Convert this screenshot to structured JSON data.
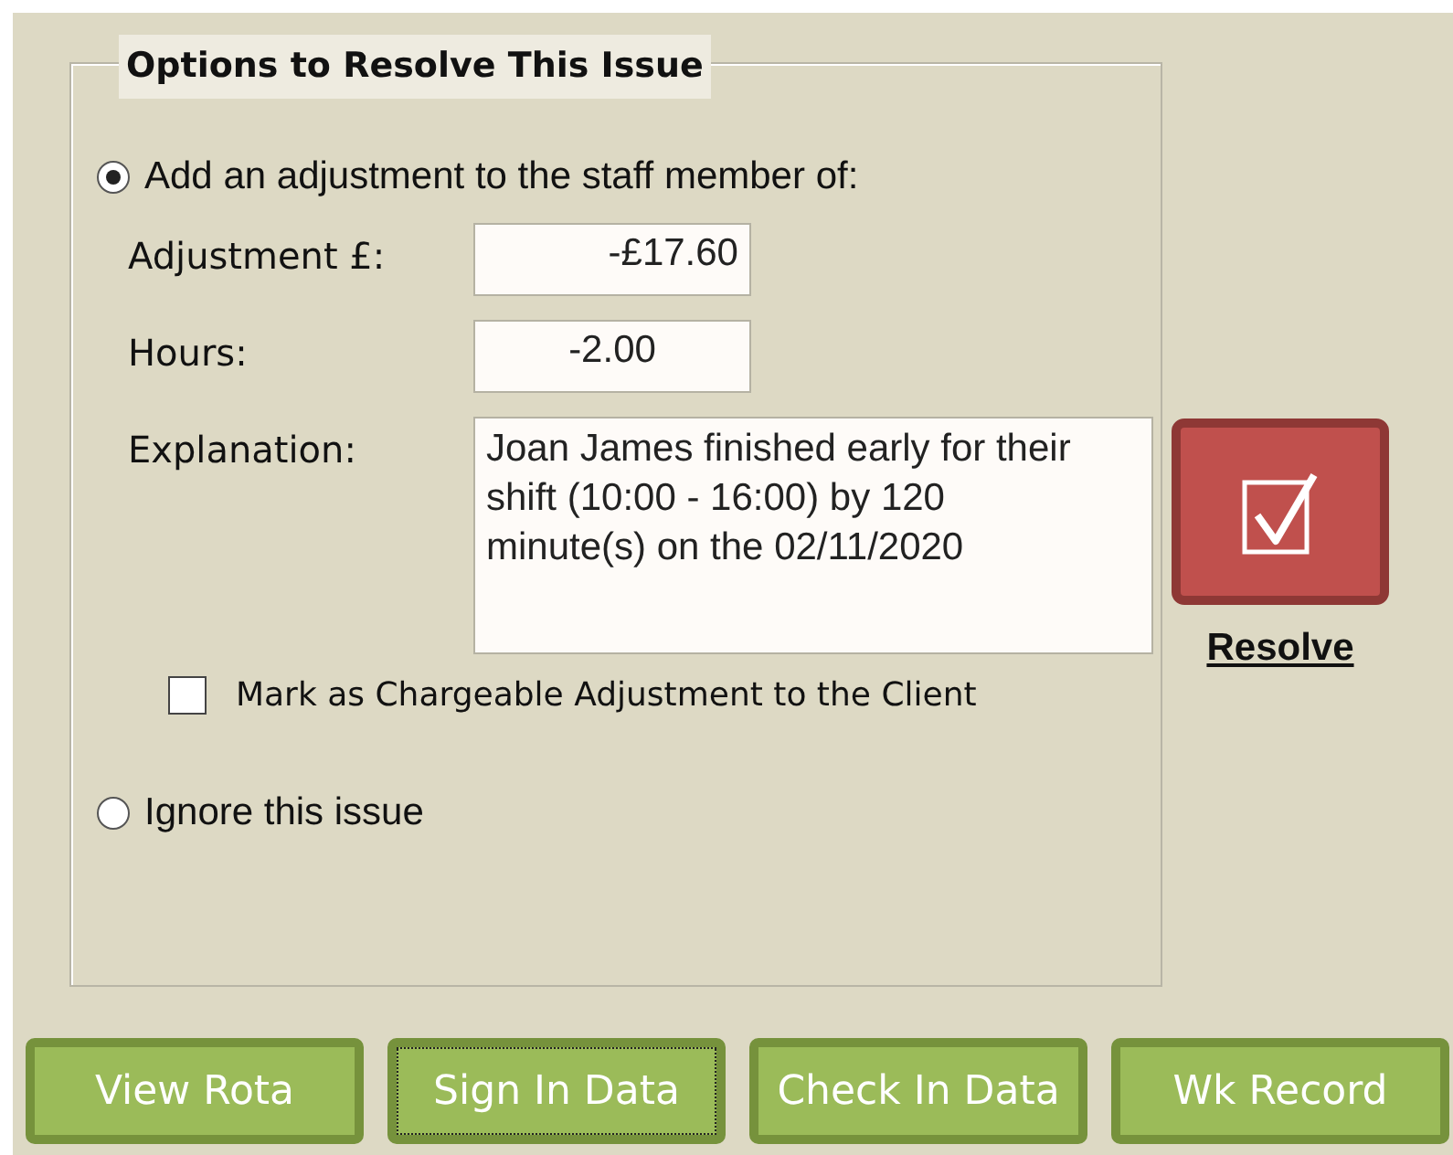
{
  "group_title": "Options to Resolve This Issue",
  "options": [
    {
      "label": "Add an adjustment to the staff member of:",
      "selected": true
    },
    {
      "label": "Ignore this issue",
      "selected": false
    }
  ],
  "fields": [
    {
      "label": "Adjustment £:",
      "value": "-£17.60"
    },
    {
      "label": "Hours:",
      "value": "-2.00"
    }
  ],
  "explanation": {
    "label": "Explanation:",
    "value": "Joan James finished early for their shift (10:00 - 16:00) by 120 minute(s) on the 02/11/2020"
  },
  "chargeable": {
    "label": "Mark as Chargeable Adjustment to the Client",
    "checked": false
  },
  "resolve": {
    "label": "Resolve"
  },
  "buttons": [
    {
      "label": "View Rota",
      "focused": false
    },
    {
      "label": "Sign In Data",
      "focused": true
    },
    {
      "label": "Check In Data",
      "focused": false
    },
    {
      "label": "Wk Record",
      "focused": false
    }
  ]
}
